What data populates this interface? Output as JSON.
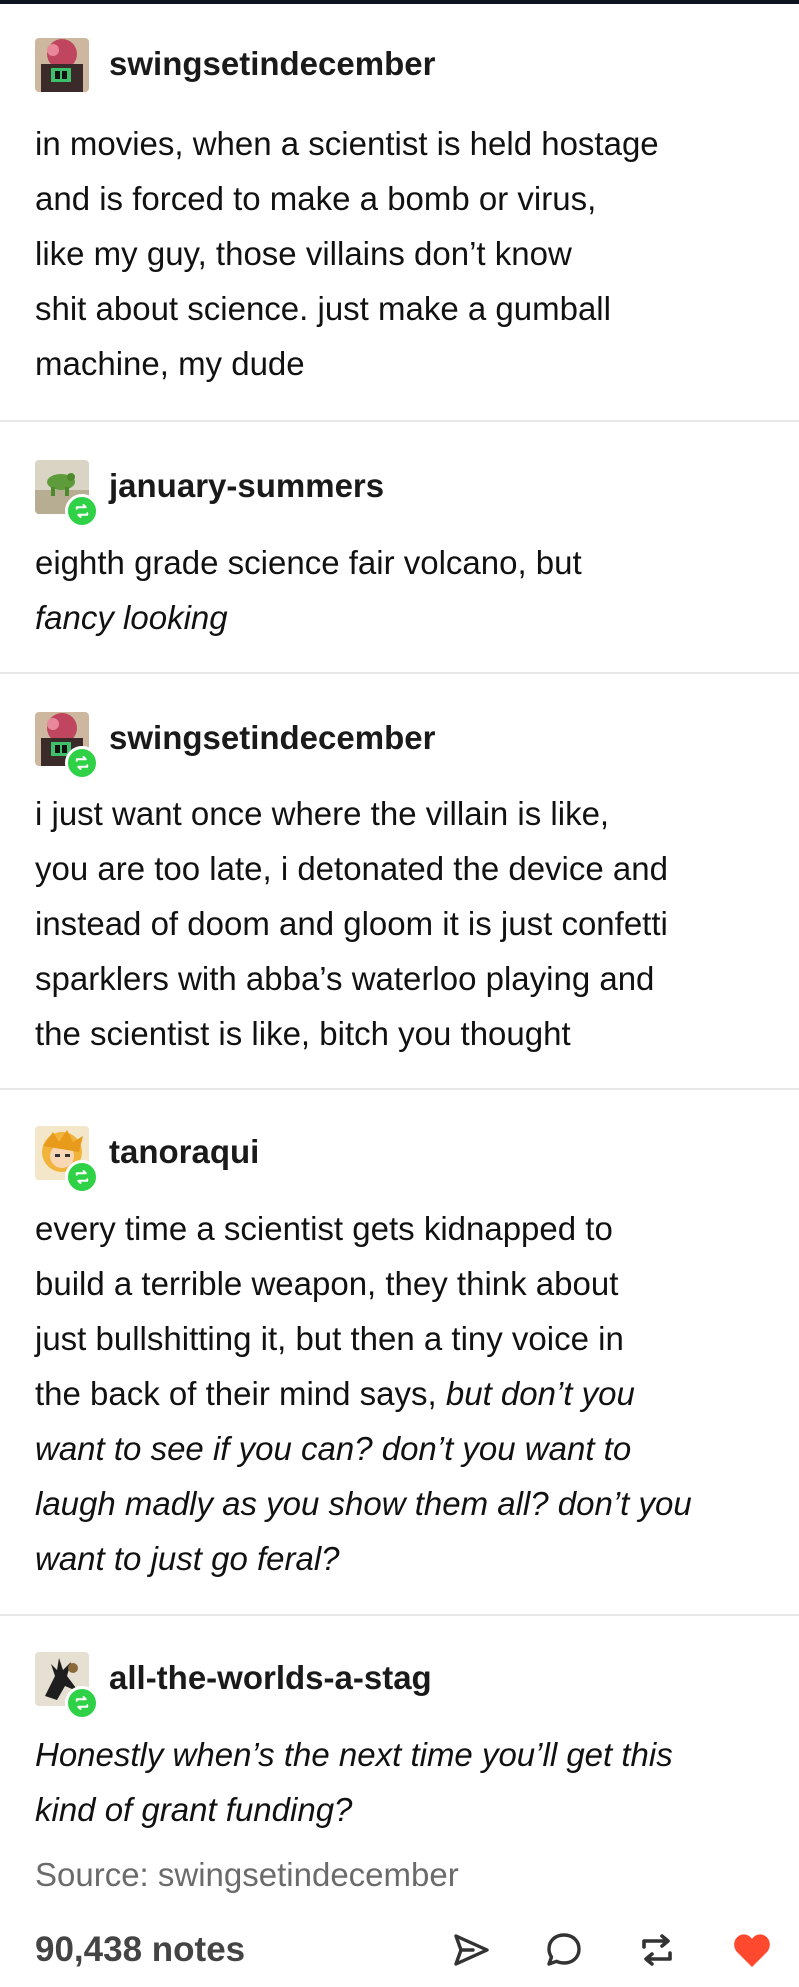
{
  "posts": [
    {
      "username": "swingsetindecember",
      "is_reblog": false,
      "lines": [
        {
          "text": "in movies, when a scientist is held hostage",
          "italic": false
        },
        {
          "text": "and is forced to make a bomb or virus,",
          "italic": false
        },
        {
          "text": "like my guy, those villains don’t know",
          "italic": false
        },
        {
          "text": "shit about science. just make a gumball",
          "italic": false
        },
        {
          "text": "machine, my dude",
          "italic": false
        }
      ]
    },
    {
      "username": "january-summers",
      "is_reblog": true,
      "lines": [
        {
          "text": "eighth grade science fair volcano, but",
          "italic": false
        },
        {
          "text": "fancy looking",
          "italic": true
        }
      ]
    },
    {
      "username": "swingsetindecember",
      "is_reblog": true,
      "lines": [
        {
          "text": "i just want once where the villain is like,",
          "italic": false
        },
        {
          "text": "you are too late, i detonated the device and",
          "italic": false
        },
        {
          "text": "instead of doom and gloom it is just confetti",
          "italic": false
        },
        {
          "text": "sparklers with abba’s waterloo playing and",
          "italic": false
        },
        {
          "text": "the scientist is like, bitch you thought",
          "italic": false
        }
      ]
    },
    {
      "username": "tanoraqui",
      "is_reblog": true,
      "lines": [
        {
          "text": "every time a scientist gets kidnapped to",
          "italic": false
        },
        {
          "text": "build a terrible weapon, they think about",
          "italic": false
        },
        {
          "text": "just bullshitting it, but then a tiny voice in",
          "italic": false
        },
        {
          "text": "the back of their mind says, ",
          "italic": false,
          "italic_tail": "but don’t you"
        },
        {
          "text": "want to see if you can? don’t you want to",
          "italic": true
        },
        {
          "text": "laugh madly as you show them all? don’t you",
          "italic": true
        },
        {
          "text": "want to just go feral?",
          "italic": true
        }
      ]
    },
    {
      "username": "all-the-worlds-a-stag",
      "is_reblog": true,
      "lines": [
        {
          "text": "Honestly when’s the next time you’ll get this",
          "italic": true
        },
        {
          "text": "kind of grant funding?",
          "italic": true
        }
      ]
    }
  ],
  "footer": {
    "source": "Source: swingsetindecember",
    "notes": "90,438 notes"
  },
  "icons": {
    "share": "paper-plane-icon",
    "reply": "speech-bubble-icon",
    "reblog": "reblog-icon",
    "like": "heart-icon"
  },
  "colors": {
    "reblog_badge": "#2fd147",
    "heart": "#ff492f",
    "username": "#1a1a1a",
    "source": "#6b6b6b",
    "divider": "#e8e8e8"
  }
}
